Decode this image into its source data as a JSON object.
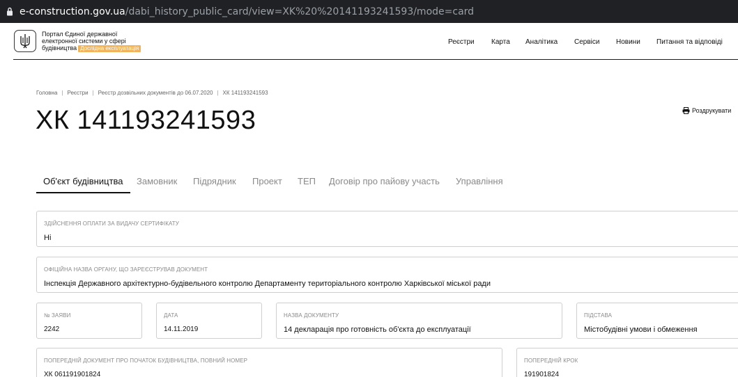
{
  "browser": {
    "url_host": "e-construction.gov.ua",
    "url_path": "/dabi_history_public_card/view=XK%20%20141193241593/mode=card"
  },
  "header": {
    "portal_line1": "Портал Єдиної державної",
    "portal_line2": "електронної системи у сфері",
    "portal_line3": "будівництва",
    "badge": "Дослідна експлуатація",
    "nav": [
      "Реєстри",
      "Карта",
      "Аналітика",
      "Сервіси",
      "Новини",
      "Питання та відповіді"
    ]
  },
  "breadcrumb": [
    "Головна",
    "Реєстри",
    "Реєстр дозвільних документів до 06.07.2020",
    "ХК 141193241593"
  ],
  "page": {
    "title": "ХК 141193241593",
    "print_label": "Роздрукувати"
  },
  "tabs": [
    {
      "label": "Об'єкт будівництва",
      "active": true
    },
    {
      "label": "Замовник",
      "active": false
    },
    {
      "label": "Підрядник",
      "active": false
    },
    {
      "label": "Проект",
      "active": false
    },
    {
      "label": "ТЕП",
      "active": false
    },
    {
      "label": "Договір про пайову участь",
      "active": false
    },
    {
      "label": "Управління",
      "active": false
    }
  ],
  "fields": {
    "payment": {
      "label": "Здійснення оплати за видачу сертифікату",
      "value": "Ні"
    },
    "authority": {
      "label": "Офіційна назва органу, що зареєстрував документ",
      "value": "Інспекція Державного архітектурно-будівельного контролю Департаменту територіального контролю Харківської міської ради"
    },
    "application_no": {
      "label": "№ заяви",
      "value": "2242"
    },
    "date": {
      "label": "Дата",
      "value": "14.11.2019"
    },
    "doc_name": {
      "label": "Назва документу",
      "value": "14 декларація про готовність об'єкта до експлуатації"
    },
    "basis": {
      "label": "Підстава",
      "value": "Містобудівні умови і обмеження"
    },
    "prev_doc": {
      "label": "Попередній документ про початок будівництва, повний номер",
      "value": "ХК 061191901824"
    },
    "prev_step": {
      "label": "Попередній крок",
      "value": "191901824"
    }
  }
}
